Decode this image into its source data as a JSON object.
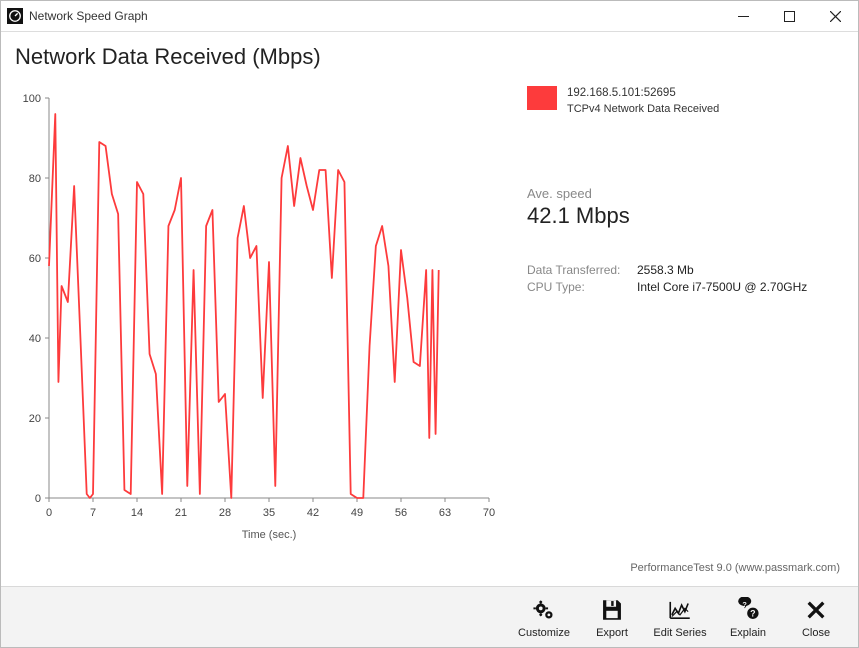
{
  "window": {
    "title": "Network Speed Graph"
  },
  "chart_data": {
    "type": "line",
    "title": "Network Data Received (Mbps)",
    "xlabel": "Time (sec.)",
    "ylabel": "",
    "xlim": [
      0,
      70
    ],
    "ylim": [
      0,
      100
    ],
    "xticks": [
      0,
      7,
      14,
      21,
      28,
      35,
      42,
      49,
      56,
      63,
      70
    ],
    "yticks": [
      0,
      20,
      40,
      60,
      80,
      100
    ],
    "series": [
      {
        "name": "192.168.5.101:52695",
        "subtitle": "TCPv4 Network Data Received",
        "color": "#fd3b3c",
        "x": [
          0,
          1,
          1.5,
          2,
          3,
          4,
          5,
          6,
          6.5,
          7,
          8,
          9,
          10,
          11,
          12,
          13,
          14,
          15,
          16,
          17,
          18,
          19,
          20,
          21,
          22,
          23,
          24,
          25,
          26,
          27,
          28,
          29,
          30,
          31,
          32,
          33,
          34,
          35,
          36,
          37,
          38,
          39,
          40,
          41,
          42,
          43,
          44,
          45,
          46,
          47,
          48,
          49,
          50,
          51,
          52,
          53,
          54,
          55,
          56,
          57,
          58,
          59,
          60,
          60.5,
          61,
          61.5,
          62
        ],
        "y": [
          58,
          96,
          29,
          53,
          49,
          78,
          40,
          1,
          0,
          1,
          89,
          88,
          76,
          71,
          2,
          1,
          79,
          76,
          36,
          31,
          1,
          68,
          72,
          80,
          3,
          57,
          1,
          68,
          72,
          24,
          26,
          0,
          65,
          73,
          60,
          63,
          25,
          59,
          3,
          80,
          88,
          73,
          85,
          78,
          72,
          82,
          82,
          55,
          82,
          79,
          1,
          0,
          0,
          38,
          63,
          68,
          58,
          29,
          62,
          50,
          34,
          33,
          57,
          15,
          57,
          16,
          57
        ]
      }
    ]
  },
  "legend": {
    "line1": "192.168.5.101:52695",
    "line2": "TCPv4 Network Data Received"
  },
  "stats": {
    "avg_label": "Ave. speed",
    "avg_value": "42.1 Mbps",
    "data_transferred_label": "Data Transferred:",
    "data_transferred_value": "2558.3 Mb",
    "cpu_type_label": "CPU Type:",
    "cpu_type_value": "Intel Core i7-7500U @ 2.70GHz"
  },
  "footer_note": "PerformanceTest 9.0 (www.passmark.com)",
  "toolbar": {
    "customize": "Customize",
    "export": "Export",
    "edit_series": "Edit Series",
    "explain": "Explain",
    "close": "Close"
  }
}
